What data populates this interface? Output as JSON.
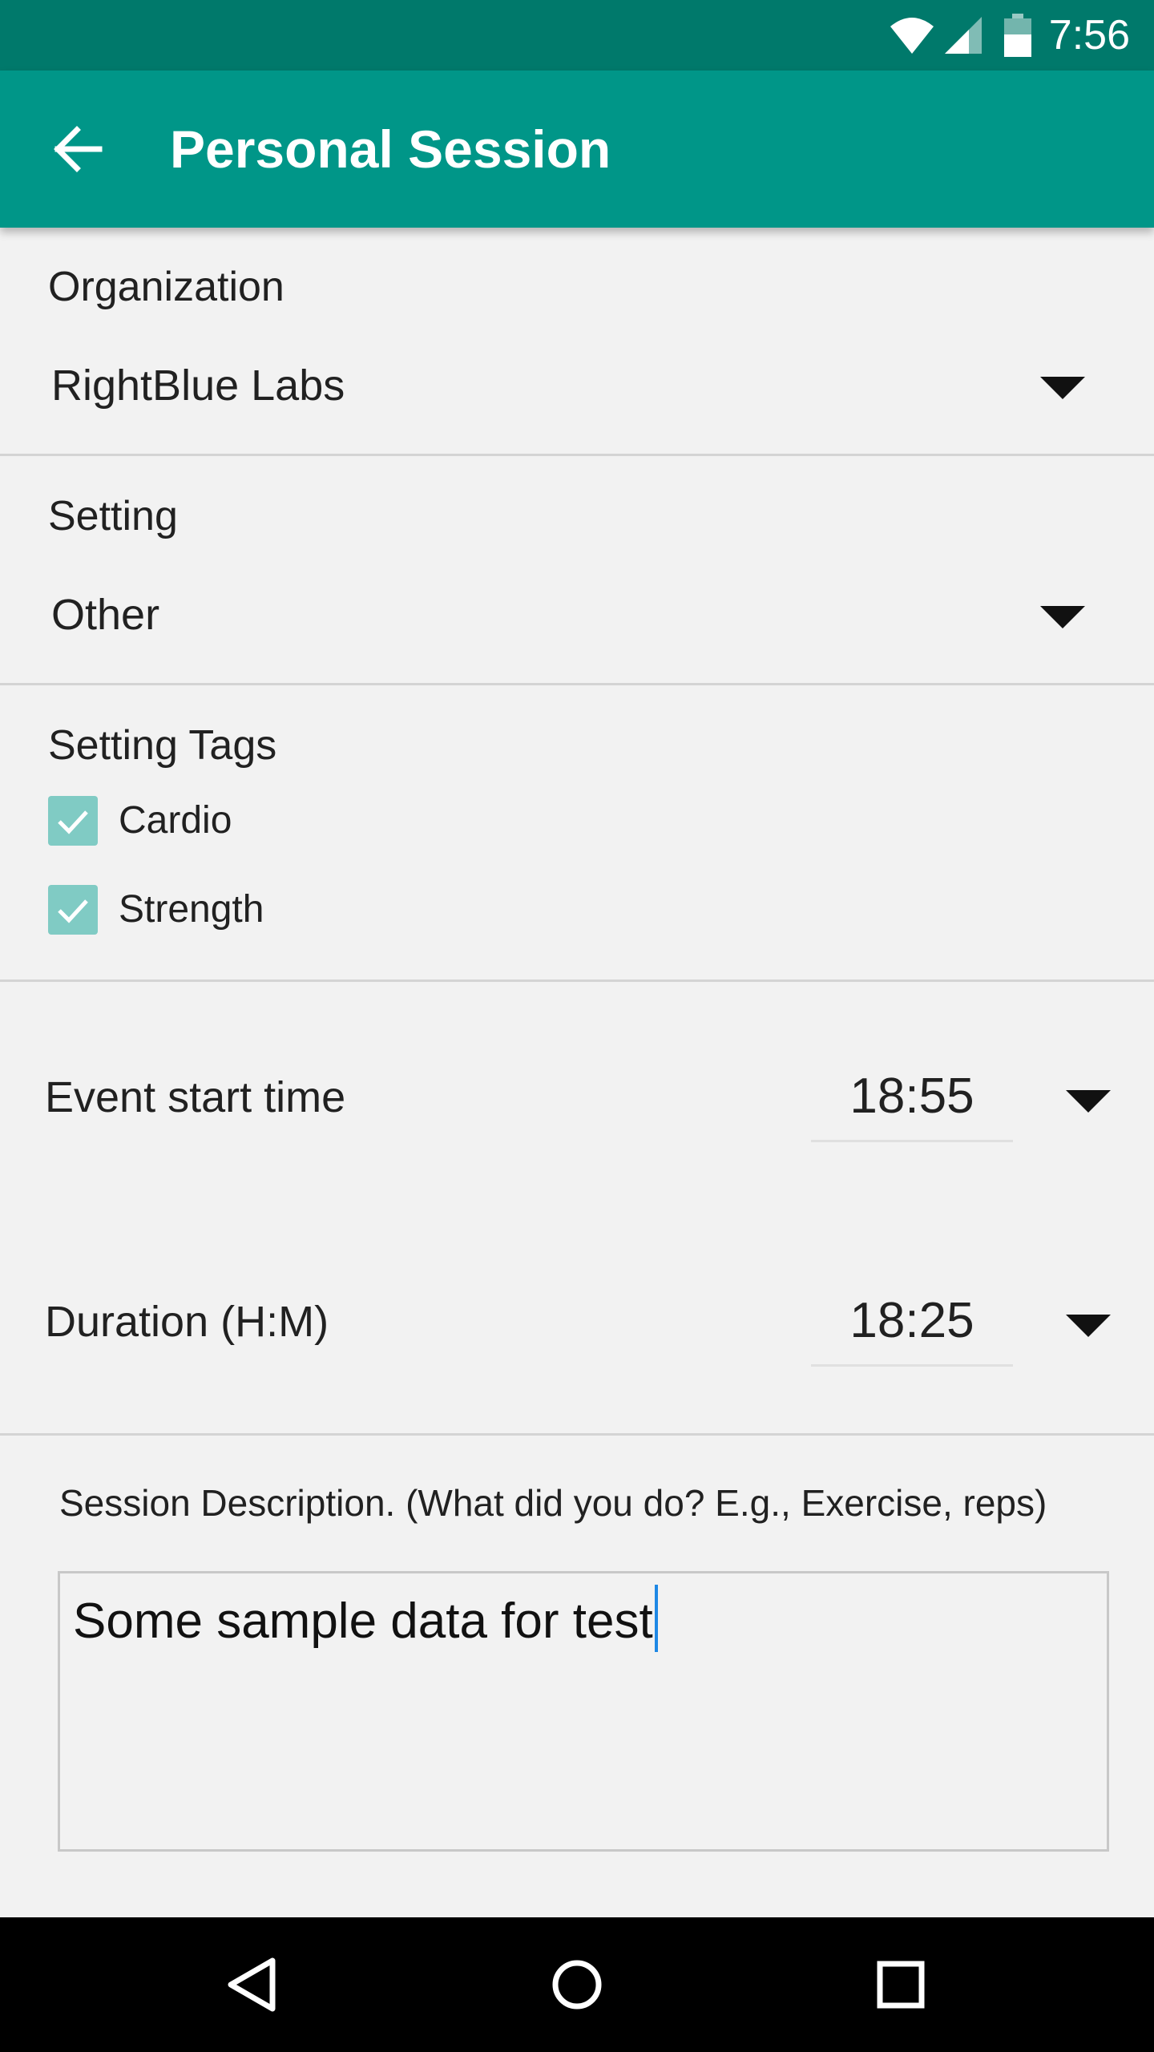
{
  "status_bar": {
    "time": "7:56",
    "icons": [
      "wifi-icon",
      "cell-signal-icon",
      "battery-icon"
    ]
  },
  "app_bar": {
    "back_icon": "arrow-back-icon",
    "title": "Personal Session",
    "color": "#009688",
    "status_color": "#00796b"
  },
  "organization": {
    "label": "Organization",
    "selected": "RightBlue Labs"
  },
  "setting": {
    "label": "Setting",
    "selected": "Other"
  },
  "setting_tags": {
    "label": "Setting Tags",
    "items": [
      {
        "label": "Cardio",
        "checked": true
      },
      {
        "label": "Strength",
        "checked": true
      }
    ],
    "checkbox_color": "#80cbc4"
  },
  "event_start": {
    "label": "Event start time",
    "value": "18:55"
  },
  "duration": {
    "label": "Duration (H:M)",
    "value": "18:25"
  },
  "description": {
    "label": "Session Description. (What did you do? E.g., Exercise, reps)",
    "value": "Some sample data for test"
  },
  "nav_bar": {
    "icons": [
      "back-triangle-icon",
      "home-circle-icon",
      "recents-square-icon"
    ]
  }
}
